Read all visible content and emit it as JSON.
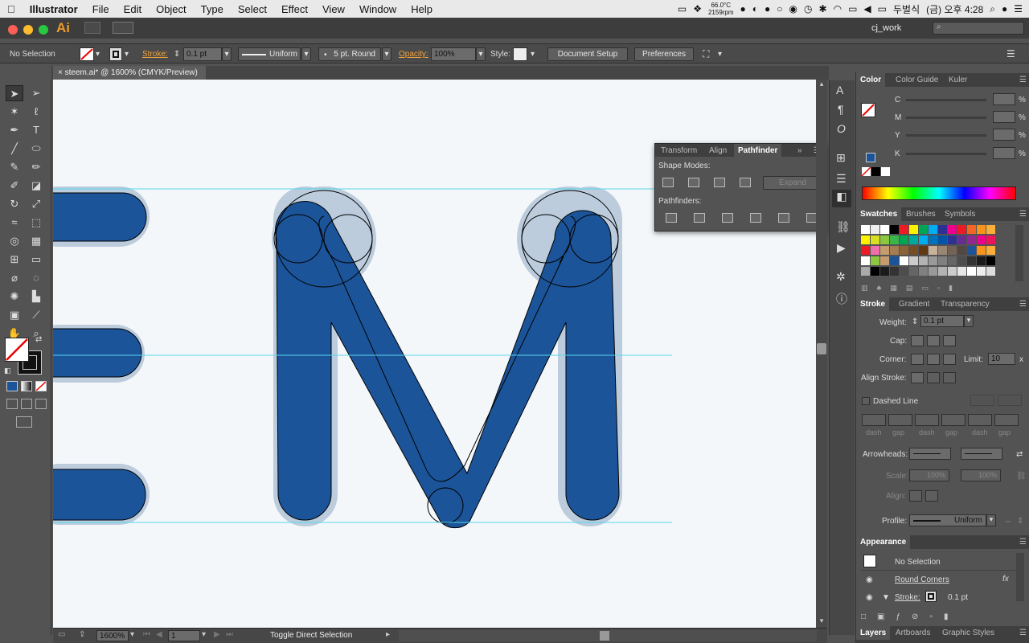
{
  "menubar": {
    "app": "Illustrator",
    "items": [
      "File",
      "Edit",
      "Object",
      "Type",
      "Select",
      "Effect",
      "View",
      "Window",
      "Help"
    ],
    "temp": "66.0°C",
    "rpm": "2159rpm",
    "user": "두벌식",
    "clock": "(금) 오후 4:28"
  },
  "titlebar": {
    "logo": "Ai",
    "workspace": "cj_work"
  },
  "control": {
    "selection": "No Selection",
    "stroke_label": "Stroke:",
    "stroke_weight": "0.1 pt",
    "profile": "Uniform",
    "brush": "5 pt. Round",
    "opacity_label": "Opacity:",
    "opacity": "100%",
    "style_label": "Style:",
    "doc_setup": "Document Setup",
    "preferences": "Preferences"
  },
  "document": {
    "tab": "steem.ai* @ 1600% (CMYK/Preview)"
  },
  "status": {
    "zoom": "1600%",
    "artboard": "1",
    "tool": "Toggle Direct Selection"
  },
  "pathfinder": {
    "tabs": [
      "Transform",
      "Align",
      "Pathfinder"
    ],
    "shape_modes": "Shape Modes:",
    "expand": "Expand",
    "pathfinders": "Pathfinders:"
  },
  "color_panel": {
    "tabs": [
      "Color",
      "Color Guide",
      "Kuler"
    ],
    "channels": [
      "C",
      "M",
      "Y",
      "K"
    ],
    "unit": "%"
  },
  "swatches_panel": {
    "tabs": [
      "Swatches",
      "Brushes",
      "Symbols"
    ]
  },
  "stroke_panel": {
    "tabs": [
      "Stroke",
      "Gradient",
      "Transparency"
    ],
    "weight_label": "Weight:",
    "weight": "0.1 pt",
    "cap_label": "Cap:",
    "corner_label": "Corner:",
    "limit_label": "Limit:",
    "limit": "10",
    "limit_unit": "x",
    "align_label": "Align Stroke:",
    "dashed": "Dashed Line",
    "dash_labels": [
      "dash",
      "gap",
      "dash",
      "gap",
      "dash",
      "gap"
    ],
    "arrowheads": "Arrowheads:",
    "scale": "Scale:",
    "scale_a": "100%",
    "scale_b": "100%",
    "align": "Align:",
    "profile_label": "Profile:",
    "profile": "Uniform"
  },
  "appearance": {
    "title": "Appearance",
    "no_selection": "No Selection",
    "round_corners": "Round Corners",
    "stroke_label": "Stroke:",
    "stroke_value": "0.1 pt"
  },
  "bottom_tabs": [
    "Layers",
    "Artboards",
    "Graphic Styles"
  ],
  "colors": {
    "fill": "#1c5499",
    "guide": "#56d8ee",
    "accent": "#f3a43c"
  }
}
